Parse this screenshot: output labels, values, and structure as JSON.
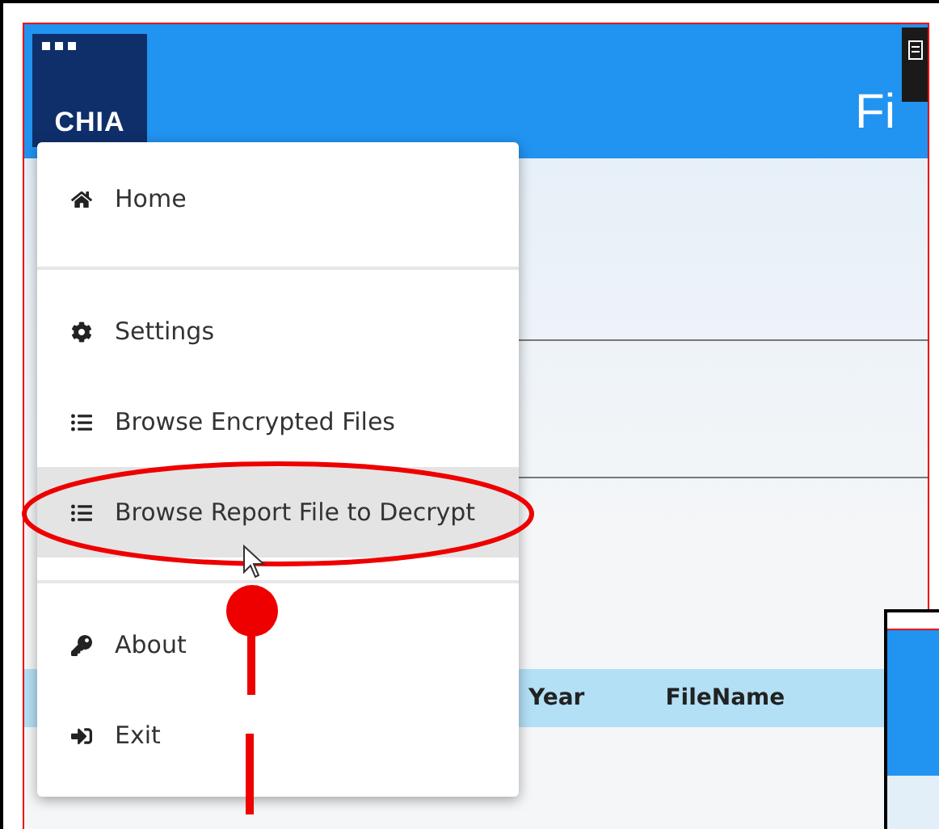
{
  "app": {
    "logo": "CHIA",
    "title": "Fi"
  },
  "menu": {
    "groups": [
      {
        "items": [
          {
            "kind": "home",
            "label": "Home",
            "selected": false
          }
        ]
      },
      {
        "items": [
          {
            "kind": "settings",
            "label": "Settings",
            "selected": false
          },
          {
            "kind": "list",
            "label": "Browse Encrypted Files",
            "selected": false
          },
          {
            "kind": "list",
            "label": "Browse Report File to Decrypt",
            "selected": true
          }
        ]
      },
      {
        "items": [
          {
            "kind": "key",
            "label": "About",
            "selected": false
          },
          {
            "kind": "exit",
            "label": "Exit",
            "selected": false
          }
        ]
      }
    ]
  },
  "table": {
    "columns": [
      "Year",
      "FileName"
    ]
  }
}
